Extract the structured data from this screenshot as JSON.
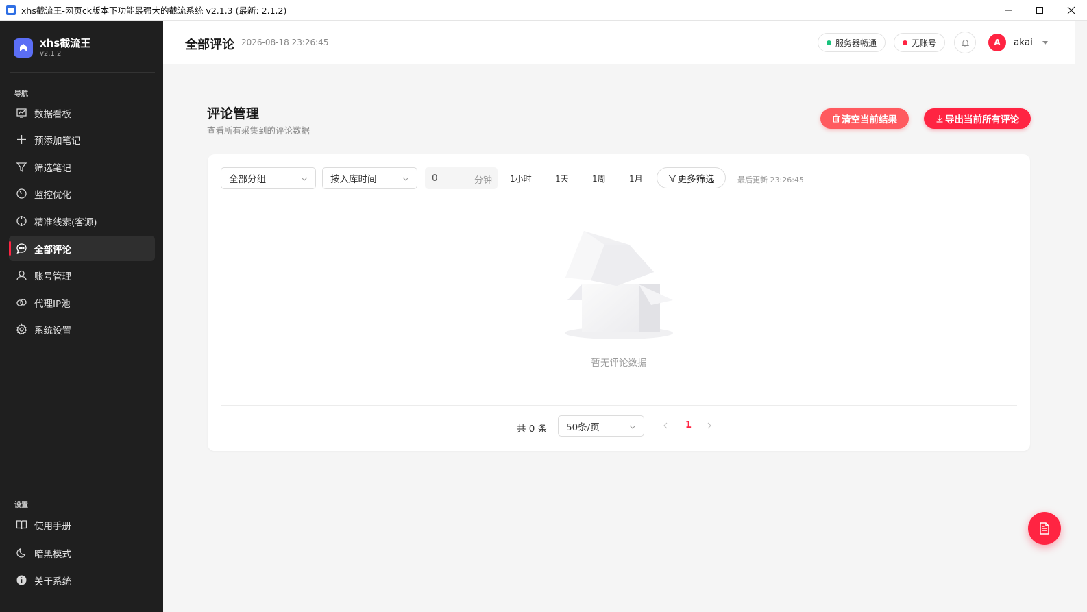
{
  "window": {
    "title": "xhs截流王-网页ck版本下功能最强大的截流系统 v2.1.3 (最新: 2.1.2)"
  },
  "brand": {
    "name": "xhs截流王",
    "version": "v2.1.2"
  },
  "sidebar": {
    "nav_label": "导航",
    "items": [
      {
        "label": "数据看板",
        "icon": "chart-icon"
      },
      {
        "label": "预添加笔记",
        "icon": "plus-icon"
      },
      {
        "label": "筛选笔记",
        "icon": "filter-icon"
      },
      {
        "label": "监控优化",
        "icon": "gauge-icon"
      },
      {
        "label": "精准线索(客源)",
        "icon": "target-icon"
      },
      {
        "label": "全部评论",
        "icon": "comment-icon",
        "active": true
      },
      {
        "label": "账号管理",
        "icon": "user-icon"
      },
      {
        "label": "代理IP池",
        "icon": "link-icon"
      },
      {
        "label": "系统设置",
        "icon": "gear-icon"
      }
    ],
    "settings_label": "设置",
    "bottom_items": [
      {
        "label": "使用手册",
        "icon": "book-icon"
      },
      {
        "label": "暗黑模式",
        "icon": "moon-icon"
      },
      {
        "label": "关于系统",
        "icon": "info-icon"
      }
    ]
  },
  "header": {
    "title": "全部评论",
    "datetime": "2026-08-18 23:26:45",
    "server_status": "服务器畅通",
    "server_status_color": "#19c37d",
    "account_status": "无账号",
    "account_status_color": "#ff2442",
    "user_initial": "A",
    "username": "akai"
  },
  "main": {
    "title": "评论管理",
    "subtitle": "查看所有采集到的评论数据",
    "clear_button": "清空当前结果",
    "export_button": "导出当前所有评论",
    "filters": {
      "group_select": "全部分组",
      "sort_select": "按入库时间",
      "minutes_value": "0",
      "minutes_unit": "分钟",
      "quick_ranges": [
        "1小时",
        "1天",
        "1周",
        "1月"
      ],
      "more_filter": "更多筛选",
      "last_update": "最后更新 23:26:45"
    },
    "empty_text": "暂无评论数据",
    "pagination": {
      "total": "共 0 条",
      "page_size": "50条/页",
      "current_page": "1"
    }
  },
  "colors": {
    "accent": "#ff2442",
    "sidebar_bg": "#1f1f1f",
    "brand": "#5b6ef5"
  }
}
